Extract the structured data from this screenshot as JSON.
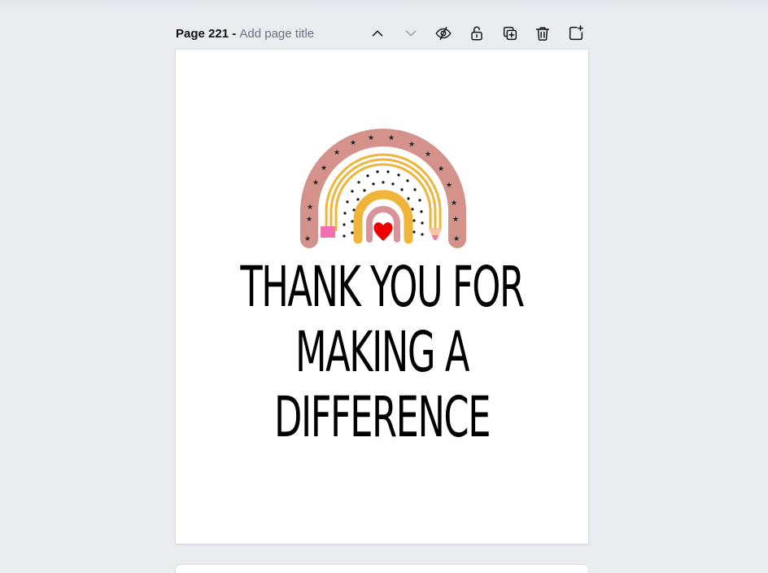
{
  "page_header": {
    "page_number": "Page 221",
    "separator": " - ",
    "title_placeholder": "Add page title"
  },
  "toolbar": {
    "items": [
      {
        "name": "move-page-up",
        "icon": "chevron-up-icon"
      },
      {
        "name": "move-page-down",
        "icon": "chevron-down-icon",
        "disabled": true
      },
      {
        "name": "hide-page",
        "icon": "eye-slash-icon"
      },
      {
        "name": "lock-page",
        "icon": "unlock-icon"
      },
      {
        "name": "duplicate-page",
        "icon": "duplicate-icon"
      },
      {
        "name": "delete-page",
        "icon": "trash-icon"
      },
      {
        "name": "add-page",
        "icon": "add-page-icon"
      }
    ]
  },
  "canvas": {
    "headline_lines": [
      "THANK YOU FOR",
      "MAKING A",
      "DIFFERENCE"
    ],
    "graphic": "rainbow-pencil-heart",
    "colors": {
      "outer_arc": "#d4928a",
      "middle_arc": "#efb53a",
      "inner_arc": "#d7959b",
      "heart": "#ee0000",
      "pencil_tip": "#f26fb0",
      "text": "#000000"
    }
  }
}
